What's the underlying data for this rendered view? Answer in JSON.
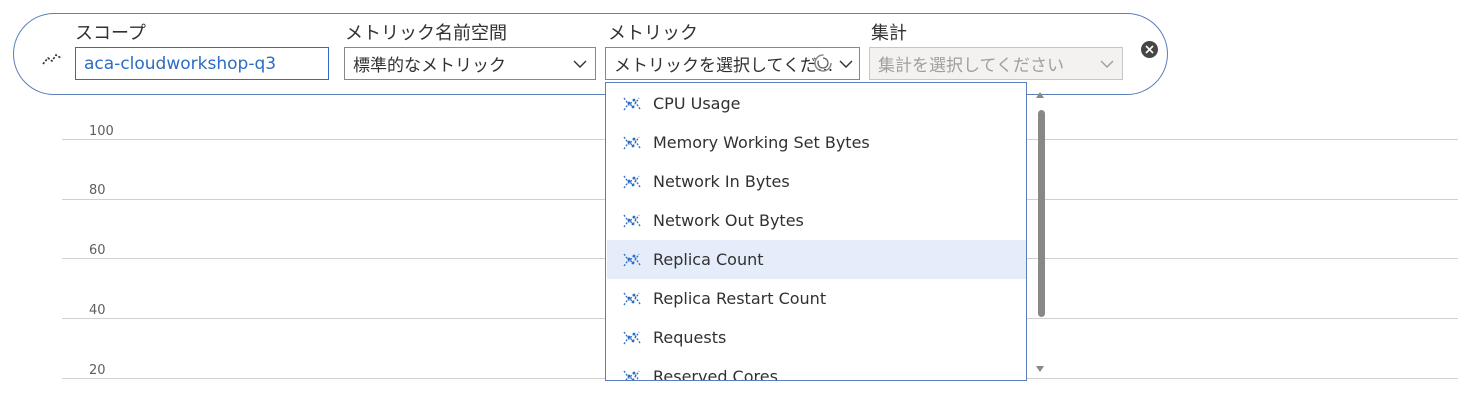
{
  "toolbar": {
    "scope": {
      "label": "スコープ",
      "value": "aca-cloudworkshop-q3"
    },
    "namespace": {
      "label": "メトリック名前空間",
      "value": "標準的なメトリック"
    },
    "metric": {
      "label": "メトリック",
      "placeholder": "メトリックを選択してくだ..."
    },
    "aggregation": {
      "label": "集計",
      "placeholder": "集計を選択してください"
    }
  },
  "metric_options": [
    {
      "label": "CPU Usage"
    },
    {
      "label": "Memory Working Set Bytes"
    },
    {
      "label": "Network In Bytes"
    },
    {
      "label": "Network Out Bytes"
    },
    {
      "label": "Replica Count",
      "selected": true
    },
    {
      "label": "Replica Restart Count"
    },
    {
      "label": "Requests"
    },
    {
      "label": "Reserved Cores"
    }
  ],
  "chart": {
    "y_ticks": [
      "100",
      "80",
      "60",
      "40",
      "20"
    ]
  },
  "colors": {
    "accent": "#2b6cc4",
    "selected_row": "#e5edfb",
    "border": "#5b7fb8"
  }
}
